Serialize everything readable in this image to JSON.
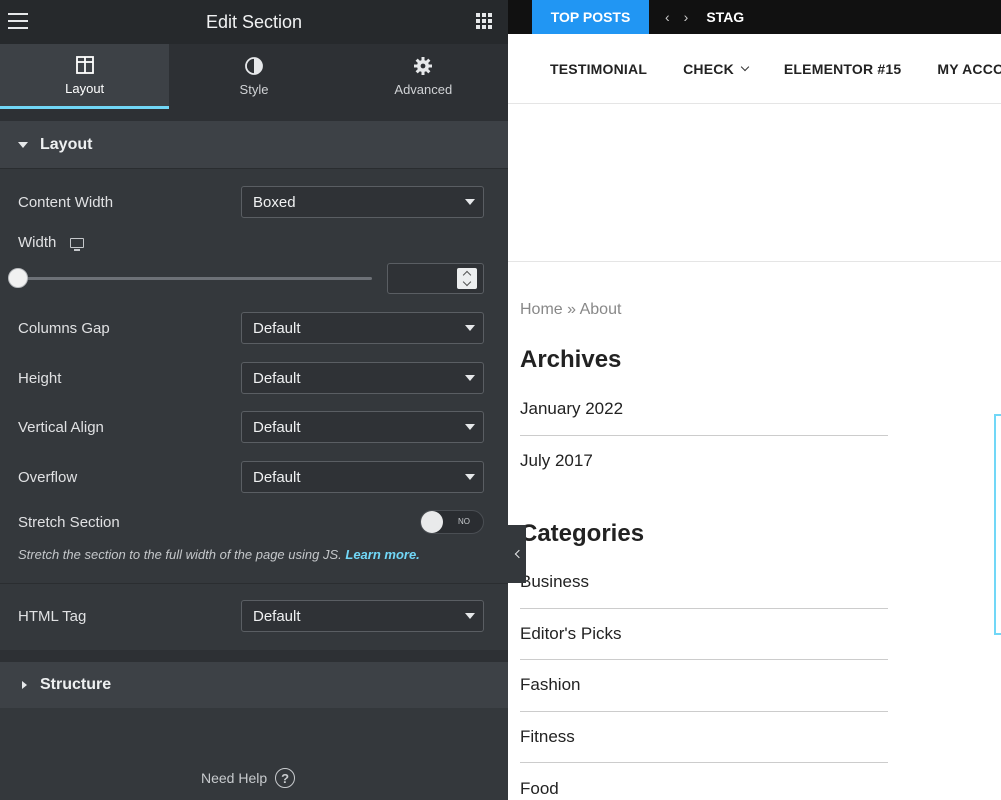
{
  "panel": {
    "title": "Edit Section",
    "tabs": [
      {
        "label": "Layout",
        "icon": "columns-icon",
        "active": true
      },
      {
        "label": "Style",
        "icon": "contrast-icon",
        "active": false
      },
      {
        "label": "Advanced",
        "icon": "gear-icon",
        "active": false
      }
    ],
    "layout_section": {
      "title": "Layout",
      "content_width": {
        "label": "Content Width",
        "value": "Boxed"
      },
      "width": {
        "label": "Width",
        "value": ""
      },
      "columns_gap": {
        "label": "Columns Gap",
        "value": "Default"
      },
      "height": {
        "label": "Height",
        "value": "Default"
      },
      "vertical_align": {
        "label": "Vertical Align",
        "value": "Default"
      },
      "overflow": {
        "label": "Overflow",
        "value": "Default"
      },
      "stretch_section": {
        "label": "Stretch Section",
        "toggle_text": "NO",
        "on": false
      },
      "help_text": "Stretch the section to the full width of the page using JS.",
      "help_link": "Learn more.",
      "html_tag": {
        "label": "HTML Tag",
        "value": "Default"
      }
    },
    "structure_section": {
      "title": "Structure"
    },
    "need_help": "Need Help",
    "accent_color": "#71d7f7"
  },
  "preview": {
    "topbar": {
      "top_posts": "TOP POSTS",
      "prev": "‹",
      "next": "›",
      "ticker": "STAG"
    },
    "menu": [
      "TESTIMONIAL",
      "CHECK",
      "ELEMENTOR #15",
      "MY ACCO"
    ],
    "breadcrumb": {
      "home": "Home",
      "sep": " » ",
      "current": "About"
    },
    "archives": {
      "title": "Archives",
      "items": [
        "January 2022",
        "July 2017"
      ]
    },
    "categories": {
      "title": "Categories",
      "items": [
        "Business",
        "Editor's Picks",
        "Fashion",
        "Fitness",
        "Food"
      ]
    },
    "brand_color": "#2196f3"
  }
}
